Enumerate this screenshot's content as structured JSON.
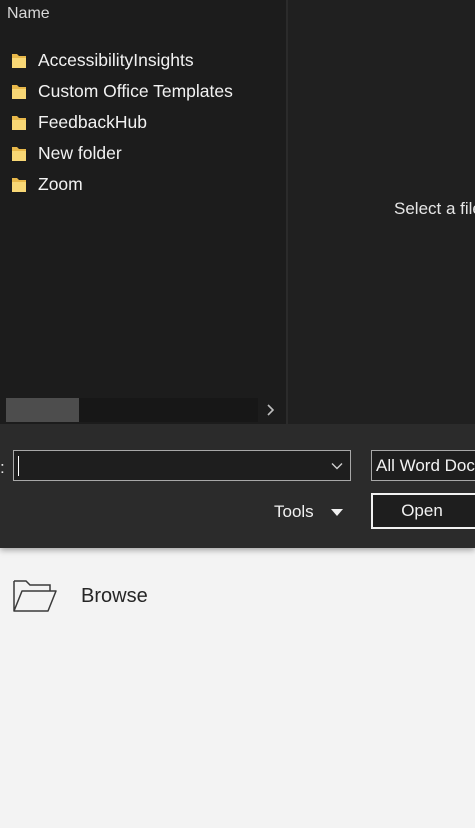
{
  "file_list": {
    "column_header": "Name",
    "items": [
      {
        "name": "AccessibilityInsights",
        "icon": "folder-icon"
      },
      {
        "name": "Custom Office Templates",
        "icon": "folder-icon"
      },
      {
        "name": "FeedbackHub",
        "icon": "folder-icon"
      },
      {
        "name": "New folder",
        "icon": "folder-icon"
      },
      {
        "name": "Zoom",
        "icon": "folder-icon"
      }
    ]
  },
  "preview": {
    "message": "Select a file"
  },
  "bottom_bar": {
    "filename_label": ":",
    "filename_value": "",
    "file_type": "All Word Documents",
    "tools_label": "Tools",
    "open_label": "Open"
  },
  "backstage": {
    "browse_label": "Browse"
  },
  "colors": {
    "dialog_bg": "#202020",
    "list_bg": "#1c1c1c",
    "bar_bg": "#2b2b2b",
    "folder_yellow": "#f8d775",
    "page_bg": "#f3f3f3"
  }
}
